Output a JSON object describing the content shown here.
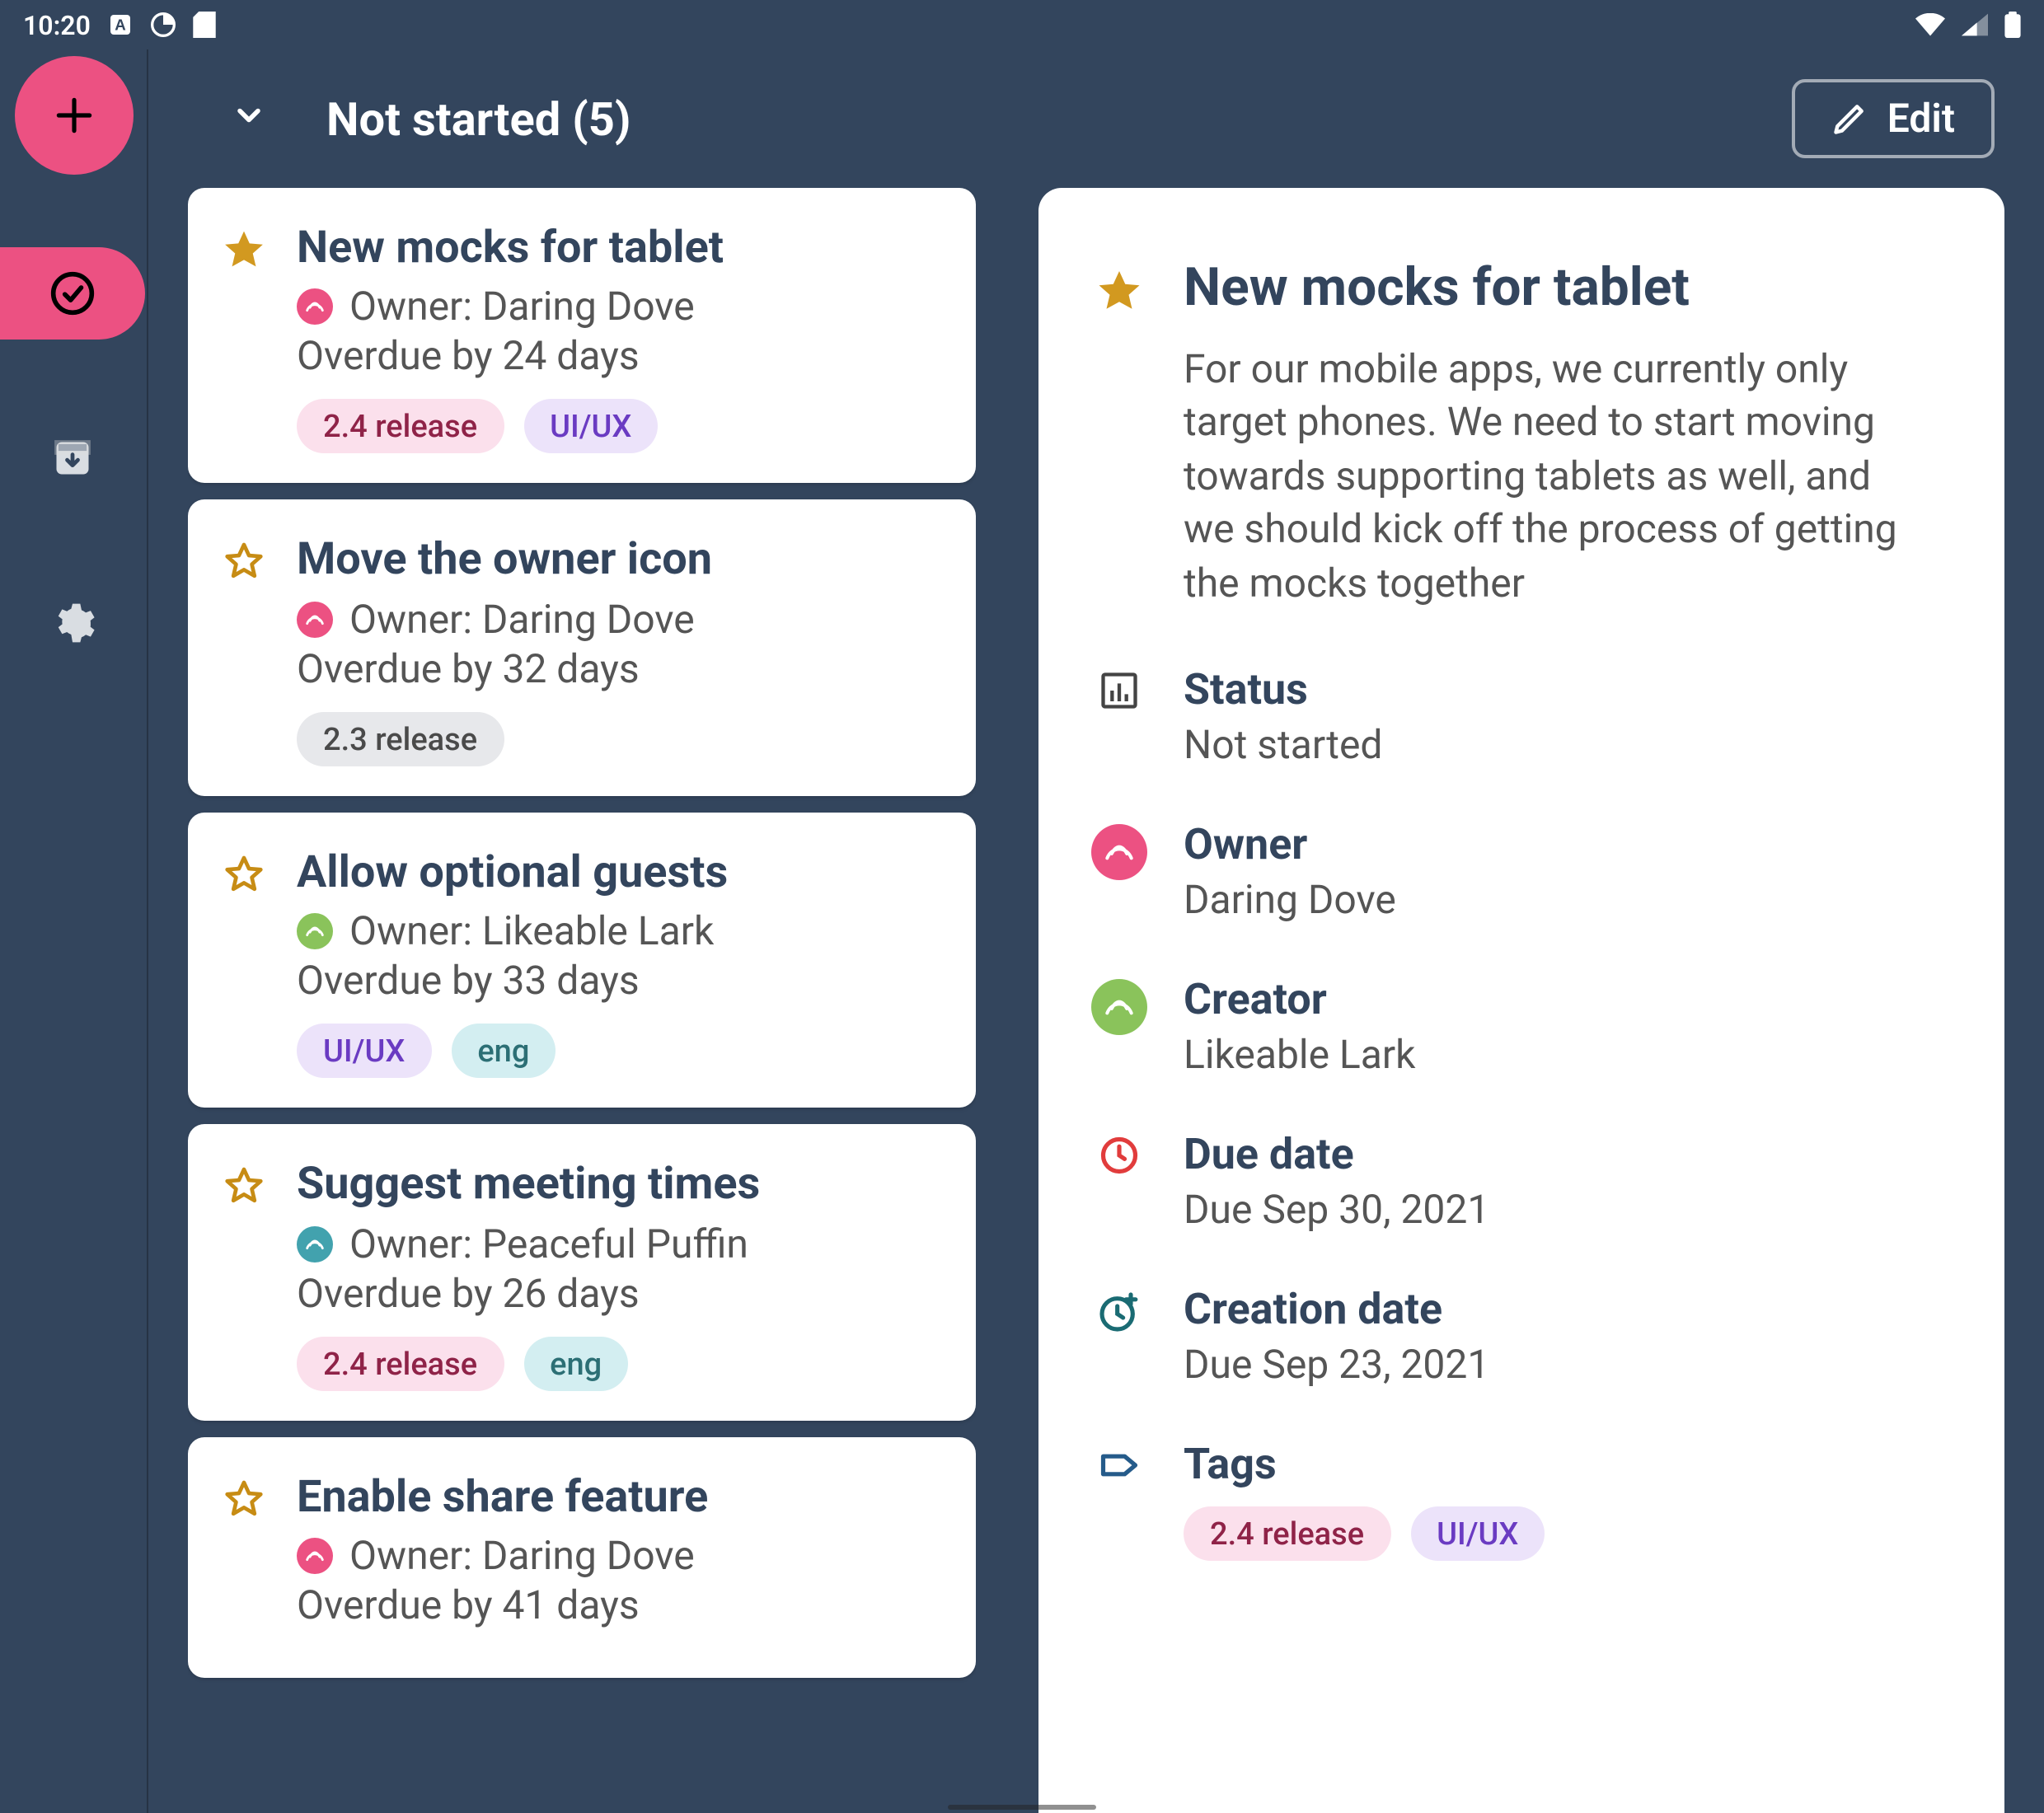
{
  "statusbar": {
    "time": "10:20"
  },
  "topbar": {
    "title": "Not started (5)",
    "edit_label": "Edit"
  },
  "tasks": {
    "items": [
      {
        "title": "New mocks for tablet",
        "starred": true,
        "owner_label": "Owner: Daring Dove",
        "owner_color": "pink",
        "overdue": "Overdue by 24 days",
        "tags": [
          {
            "label": "2.4 release",
            "color": "pink"
          },
          {
            "label": "UI/UX",
            "color": "purple"
          }
        ]
      },
      {
        "title": "Move the owner icon",
        "starred": false,
        "owner_label": "Owner: Daring Dove",
        "owner_color": "pink",
        "overdue": "Overdue by 32 days",
        "tags": [
          {
            "label": "2.3 release",
            "color": "gray"
          }
        ]
      },
      {
        "title": "Allow optional guests",
        "starred": false,
        "owner_label": "Owner: Likeable Lark",
        "owner_color": "green",
        "overdue": "Overdue by 33 days",
        "tags": [
          {
            "label": "UI/UX",
            "color": "purple"
          },
          {
            "label": "eng",
            "color": "teal"
          }
        ]
      },
      {
        "title": "Suggest meeting times",
        "starred": false,
        "owner_label": "Owner: Peaceful Puffin",
        "owner_color": "teal",
        "overdue": "Overdue by 26 days",
        "tags": [
          {
            "label": "2.4 release",
            "color": "pink"
          },
          {
            "label": "eng",
            "color": "teal"
          }
        ]
      },
      {
        "title": "Enable share feature",
        "starred": false,
        "owner_label": "Owner: Daring Dove",
        "owner_color": "pink",
        "overdue": "Overdue by 41 days",
        "tags": []
      }
    ]
  },
  "detail": {
    "title": "New mocks for tablet",
    "description": "For our mobile apps, we currently only target phones. We need to start moving towards supporting tablets as well, and we should kick off the process of getting the mocks together",
    "status": {
      "label": "Status",
      "value": "Not started"
    },
    "owner": {
      "label": "Owner",
      "value": "Daring Dove"
    },
    "creator": {
      "label": "Creator",
      "value": "Likeable Lark"
    },
    "due": {
      "label": "Due date",
      "value": "Due Sep 30, 2021"
    },
    "created": {
      "label": "Creation date",
      "value": "Due Sep 23, 2021"
    },
    "tags_label": "Tags",
    "tags": [
      {
        "label": "2.4 release",
        "color": "pink"
      },
      {
        "label": "UI/UX",
        "color": "purple"
      }
    ]
  }
}
